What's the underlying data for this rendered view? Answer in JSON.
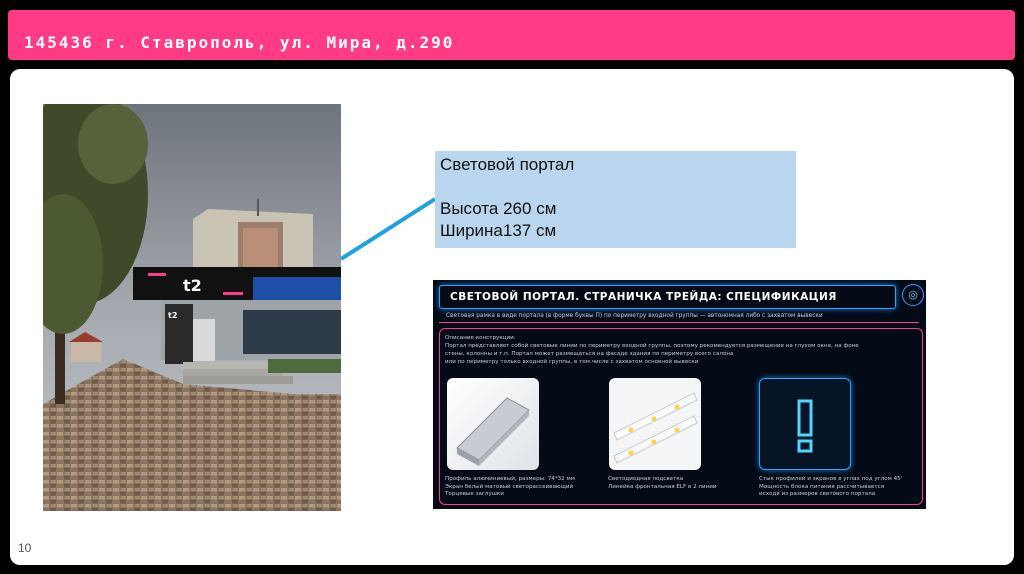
{
  "header": {
    "title": "145436 г. Ставрополь, ул. Мира, д.290"
  },
  "slide": {
    "page_number": "10"
  },
  "photo": {
    "storefront_logo": "t2",
    "side_logo": "t2"
  },
  "info_box": {
    "line1": "Световой портал",
    "line2": "",
    "line3": "Высота 260 см",
    "line4": "Ширина137 см"
  },
  "spec": {
    "title": "СВЕТОВОЙ ПОРТАЛ. СТРАНИЧКА ТРЕЙДА: СПЕЦИФИКАЦИЯ",
    "lead": "Световая рамка в виде портала (в форме буквы П) по периметру входной группы — автономная либо с захватом вывески",
    "desc_heading": "Описание конструкции:",
    "desc_line1": "Портал представляет собой световые линии по периметру входной группы, поэтому рекомендуется размещение на глухом окне, на фоне",
    "desc_line2": "стены, колонны и т.п. Портал может размещаться на фасаде здания по периметру всего салона",
    "desc_line3": "или по периметру только входной группы, в том числе с захватом основной вывески",
    "items": [
      {
        "line1": "Профиль алюминиевый, размеры: 74*32 мм",
        "line2": "Экран белый матовый светорассеивающий",
        "line3": "Торцевые заглушки"
      },
      {
        "line1": "Светодиодная подсветка",
        "line2": "Линейка фронтальная ELF в 2 линии",
        "line3": ""
      },
      {
        "line1": "Стык профилей и экранов в углах под углом 45'",
        "line2": "Мощность блока питания рассчитывается",
        "line3": "исходя из размеров светового портала"
      }
    ]
  },
  "colors": {
    "accent": "#ff3b86",
    "box": "#bad6ee",
    "line": "#1aa3e0",
    "spec_bg": "#050b16",
    "neon": "#2aa3ff"
  }
}
